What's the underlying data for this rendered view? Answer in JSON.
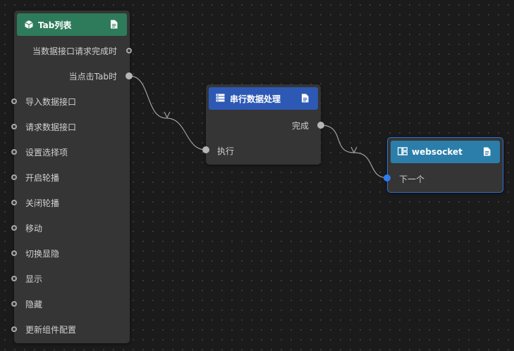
{
  "colors": {
    "canvas_bg": "#1b1b1b",
    "node_bg": "#353535",
    "tab_header": "#2e7b5b",
    "serial_header": "#2d59b5",
    "websocket_header": "#2b7eaa",
    "selection": "#2f6fd6",
    "wire": "#a0a0a0"
  },
  "nodes": {
    "tab_list": {
      "title": "Tab列表",
      "icon": "cube-icon",
      "outputs": [
        "当数据接口请求完成时",
        "当点击Tab时"
      ],
      "inputs": [
        "导入数据接口",
        "请求数据接口",
        "设置选择项",
        "开启轮播",
        "关闭轮播",
        "移动",
        "切换显隐",
        "显示",
        "隐藏",
        "更新组件配置"
      ]
    },
    "serial": {
      "title": "串行数据处理",
      "icon": "serial-list-icon",
      "output": "完成",
      "input": "执行"
    },
    "websocket": {
      "title": "websocket",
      "icon": "component-icon",
      "input": "下一个"
    }
  }
}
